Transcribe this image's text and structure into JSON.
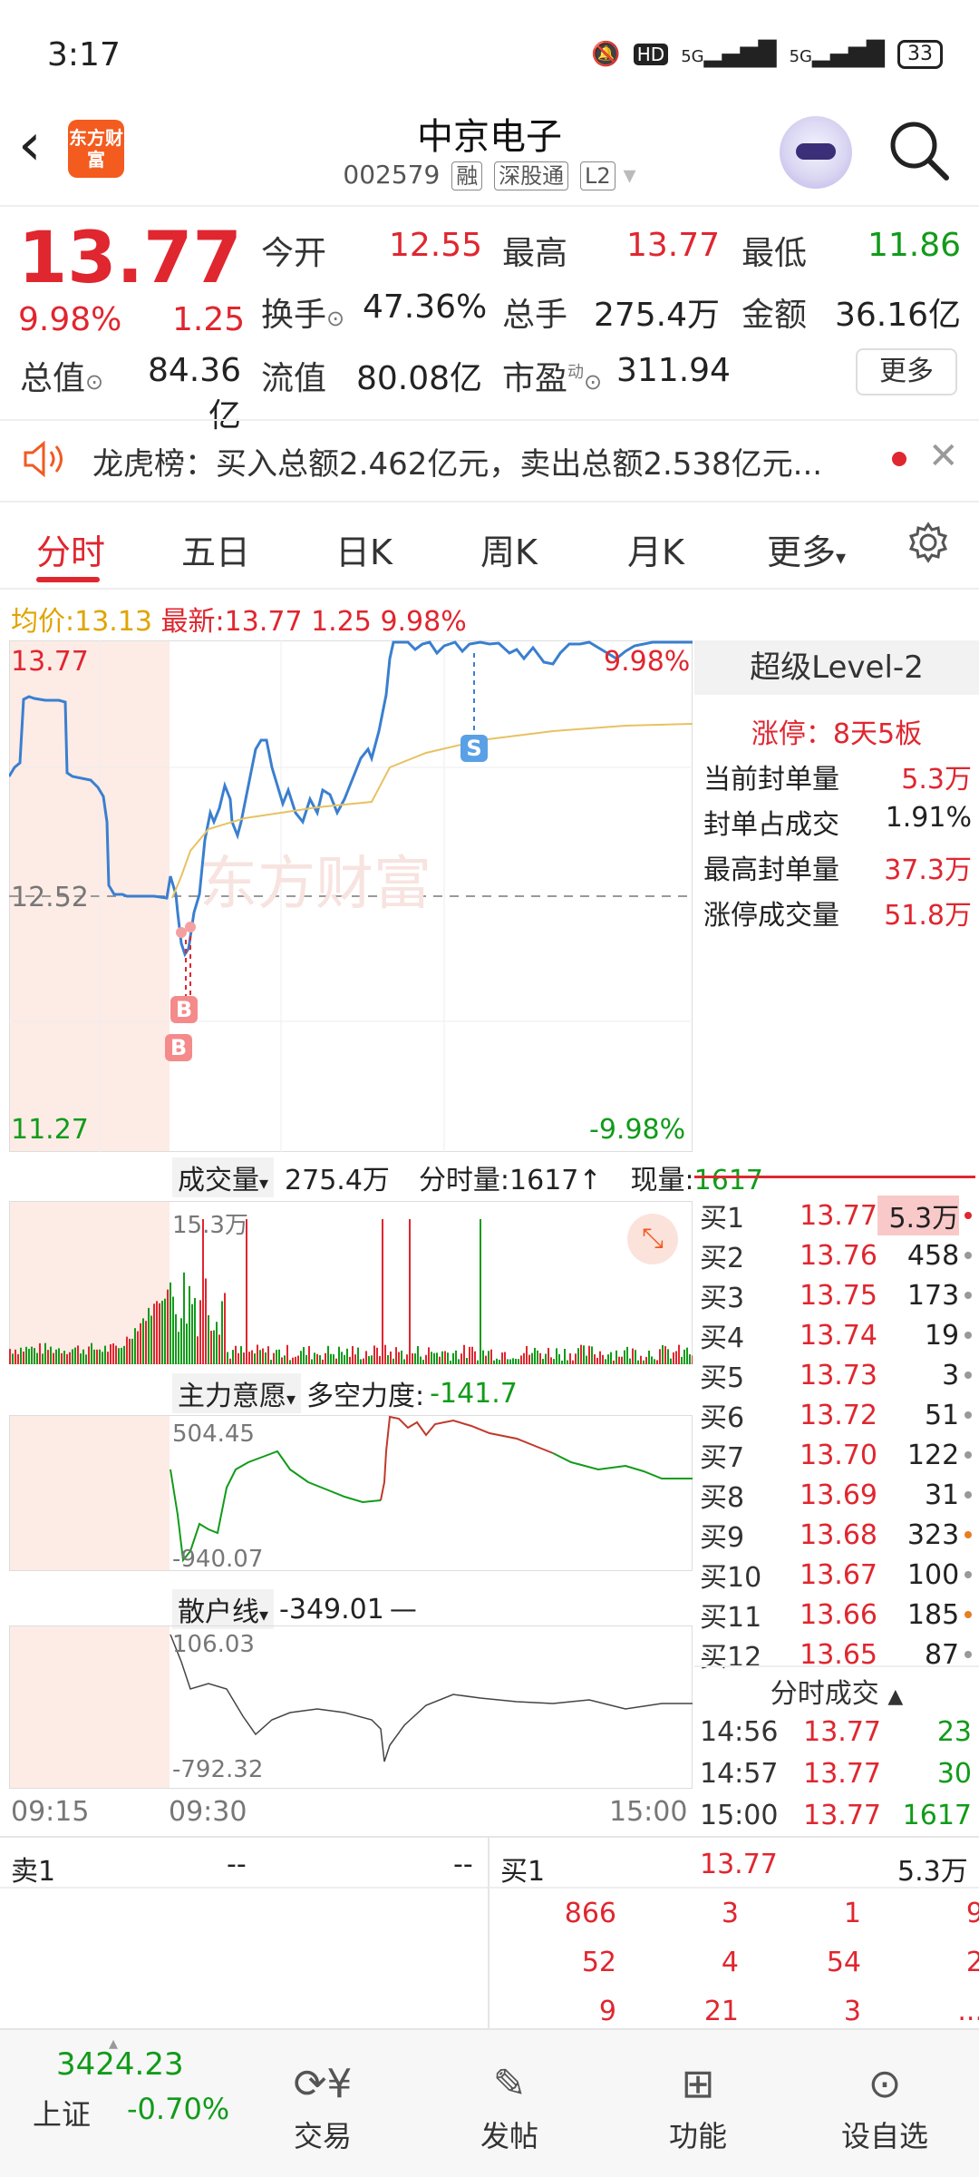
{
  "status": {
    "time": "3:17",
    "net1": "5G",
    "net2": "5G",
    "hd": "HD",
    "battery": "33"
  },
  "header": {
    "title": "中京电子",
    "code": "002579",
    "tags": [
      "融",
      "深股通",
      "L2"
    ],
    "logo": "东方财富"
  },
  "quote": {
    "price": "13.77",
    "pct": "9.98%",
    "change": "1.25",
    "items": [
      {
        "label": "今开",
        "value": "12.55",
        "color": "red"
      },
      {
        "label": "最高",
        "value": "13.77",
        "color": "red"
      },
      {
        "label": "最低",
        "value": "11.86",
        "color": "green"
      },
      {
        "label": "换手",
        "value": "47.36%",
        "color": "dark"
      },
      {
        "label": "总手",
        "value": "275.4万",
        "color": "dark"
      },
      {
        "label": "金额",
        "value": "36.16亿",
        "color": "dark"
      },
      {
        "label": "总值",
        "value": "84.36亿",
        "color": "dark"
      },
      {
        "label": "流值",
        "value": "80.08亿",
        "color": "dark"
      },
      {
        "label": "市盈",
        "value": "311.94",
        "color": "dark"
      }
    ],
    "more": "更多",
    "pe_sup": "动"
  },
  "news": {
    "text": "龙虎榜：买入总额2.462亿元，卖出总额2.538亿元..."
  },
  "tabs": [
    "分时",
    "五日",
    "日K",
    "周K",
    "月K",
    "更多"
  ],
  "avgline": {
    "avg_label": "均价:",
    "avg": "13.13",
    "last_label": "最新:",
    "last": "13.77",
    "chg": "1.25",
    "pct": "9.98%"
  },
  "chart": {
    "top": "13.77",
    "mid": "12.52",
    "bottom": "11.27",
    "top_pct": "9.98%",
    "bottom_pct": "-9.98%",
    "watermark": "东方财富",
    "markers": [
      "B",
      "B",
      "S"
    ]
  },
  "volume": {
    "label": "成交量",
    "total": "275.4万",
    "fs_label": "分时量:1617↑",
    "now_label": "现量:",
    "now": "1617",
    "scale": "15.3万"
  },
  "force": {
    "label": "主力意愿",
    "text": "多空力度:",
    "value": "-141.7",
    "top": "504.45",
    "bottom": "-940.07"
  },
  "retail": {
    "label": "散户线",
    "value": "-349.01",
    "top": "106.03",
    "bottom": "-792.32"
  },
  "times": [
    "09:15",
    "09:30",
    "15:00"
  ],
  "level2": {
    "title": "超级Level-2",
    "limit": "涨停：8天5板",
    "rows": [
      [
        "当前封单量",
        "5.3万"
      ],
      [
        "封单占成交",
        "1.91%"
      ],
      [
        "最高封单量",
        "37.3万"
      ],
      [
        "涨停成交量",
        "51.8万"
      ]
    ]
  },
  "book": [
    [
      "买1",
      "13.77",
      "5.3万",
      "#e0262f"
    ],
    [
      "买2",
      "13.76",
      "458",
      "#999"
    ],
    [
      "买3",
      "13.75",
      "173",
      "#999"
    ],
    [
      "买4",
      "13.74",
      "19",
      "#999"
    ],
    [
      "买5",
      "13.73",
      "3",
      "#999"
    ],
    [
      "买6",
      "13.72",
      "51",
      "#999"
    ],
    [
      "买7",
      "13.70",
      "122",
      "#999"
    ],
    [
      "买8",
      "13.69",
      "31",
      "#999"
    ],
    [
      "买9",
      "13.68",
      "323",
      "#e67e22"
    ],
    [
      "买10",
      "13.67",
      "100",
      "#999"
    ],
    [
      "买11",
      "13.66",
      "185",
      "#e67e22"
    ],
    [
      "买12",
      "13.65",
      "87",
      "#999"
    ]
  ],
  "trades_title": "分时成交",
  "trades": [
    [
      "14:56",
      "13.77",
      "23"
    ],
    [
      "14:57",
      "13.77",
      "30"
    ],
    [
      "15:00",
      "13.77",
      "1617"
    ]
  ],
  "orders": {
    "sell_label": "卖1",
    "sell_a": "--",
    "sell_b": "--",
    "buy_label": "买1",
    "buy_price": "13.77",
    "buy_vol": "5.3万",
    "cells": [
      [
        "866",
        "3",
        "1",
        "9"
      ],
      [
        "52",
        "4",
        "54",
        "2"
      ],
      [
        "9",
        "21",
        "3",
        "..."
      ]
    ]
  },
  "nav": {
    "index_value": "3424.23",
    "index_name": "上证",
    "index_pct": "-0.70%",
    "items": [
      "交易",
      "发帖",
      "功能",
      "设自选"
    ]
  }
}
